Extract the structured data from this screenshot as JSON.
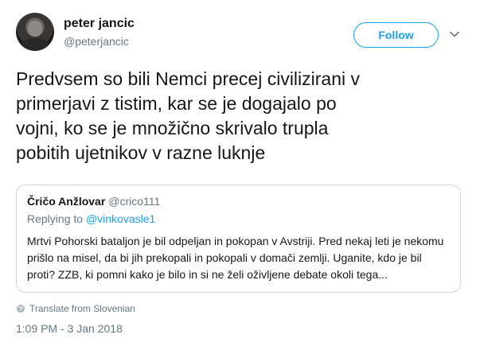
{
  "author": {
    "name": "peter jancic",
    "handle": "@peterjancic",
    "avatar_icon": "profile-photo"
  },
  "follow_label": "Follow",
  "menu_icon": "chevron-down-icon",
  "tweet": {
    "lines": [
      "Predvsem so bili Nemci precej civilizirani v",
      "primerjavi z tistim, kar se je dogajalo po",
      "vojni, ko se je množično skrivalo trupla",
      "pobitih ujetnikov v razne luknje"
    ]
  },
  "quote": {
    "name": "Čričo Anžlovar",
    "handle": "@crico111",
    "replying_prefix": "Replying to",
    "replying_handle": "@vinkovasle1",
    "lines": [
      "Mrtvi Pohorski bataljon je bil odpeljan in pokopan v Avstriji. Pred nekaj leti je nekomu",
      "prišlo na misel, da bi jih prekopali in pokopali v domači zemlji. Uganite, kdo je bil",
      "proti? ZZB, ki pomni kako je bilo in si ne želi oživljene debate okoli tega..."
    ]
  },
  "translate_label": "Translate from Slovenian",
  "translate_icon": "globe-icon",
  "timestamp": "1:09 PM - 3 Jan 2018",
  "colors": {
    "accent": "#1da1f2",
    "muted": "#657786",
    "text": "#14171a",
    "border": "#ccd6dd"
  }
}
